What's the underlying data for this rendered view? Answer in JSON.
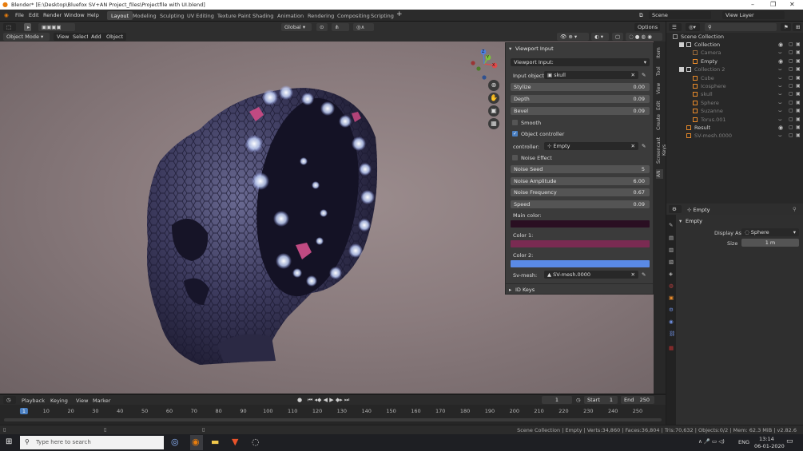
{
  "window": {
    "title": "Blender* [E:\\Desktop\\Bluefox SV+AN Project_files\\Projectfile with UI.blend]"
  },
  "menu": [
    "File",
    "Edit",
    "Render",
    "Window",
    "Help"
  ],
  "workspaces": [
    "Layout",
    "Modeling",
    "Sculpting",
    "UV Editing",
    "Texture Paint",
    "Shading",
    "Animation",
    "Rendering",
    "Compositing",
    "Scripting"
  ],
  "active_workspace": "Layout",
  "scene": {
    "label": "Scene",
    "view_layer": "View Layer"
  },
  "viewport_header": {
    "mode": "Object Mode",
    "menus": [
      "View",
      "Select",
      "Add",
      "Object"
    ],
    "transform": "Global",
    "options": "Options"
  },
  "gizmo": {
    "x": "X",
    "y": "Y",
    "z": "Z"
  },
  "viewport_input": {
    "panel_title": "Viewport Input",
    "type_label": "Viewport Input:",
    "input_object_label": "Input object:",
    "input_object": "skull",
    "stylize_label": "Stylize",
    "stylize": "0.00",
    "depth_label": "Depth",
    "depth": "0.09",
    "bevel_label": "Bevel",
    "bevel": "0.09",
    "smooth_label": "Smooth",
    "smooth": false,
    "object_controller_label": "Object controller",
    "object_controller": true,
    "controller_label": "controller:",
    "controller": "Empty",
    "noise_effect_label": "Noise Effect",
    "noise_effect": false,
    "noise_seed_label": "Noise Seed",
    "noise_seed": "5",
    "noise_amplitude_label": "Noise Amplitude",
    "noise_amplitude": "6.00",
    "noise_frequency_label": "Noise Frequency",
    "noise_frequency": "0.67",
    "speed_label": "Speed",
    "speed": "0.09",
    "main_color_label": "Main color:",
    "main_color": "#2a0f22",
    "color1_label": "Color 1:",
    "color1": "#7a2b52",
    "color2_label": "Color 2:",
    "color2": "#5a8ae6",
    "svmesh_label": "Sv-mesh:",
    "svmesh": "SV-mesh.0000",
    "id_keys_label": "ID Keys"
  },
  "side_tabs": [
    "Item",
    "Tool",
    "View",
    "Edit",
    "Create",
    "Screencast Keys",
    "AN"
  ],
  "outliner": {
    "root": "Scene Collection",
    "rows": [
      {
        "name": "Collection",
        "indent": 1,
        "type": "collection",
        "dim": false
      },
      {
        "name": "Camera",
        "indent": 2,
        "type": "camera",
        "dim": true
      },
      {
        "name": "Empty",
        "indent": 2,
        "type": "empty",
        "dim": false
      },
      {
        "name": "Collection 2",
        "indent": 1,
        "type": "collection",
        "dim": true
      },
      {
        "name": "Cube",
        "indent": 2,
        "type": "mesh",
        "dim": true
      },
      {
        "name": "Icosphere",
        "indent": 2,
        "type": "mesh",
        "dim": true
      },
      {
        "name": "skull",
        "indent": 2,
        "type": "mesh",
        "dim": true
      },
      {
        "name": "Sphere",
        "indent": 2,
        "type": "mesh",
        "dim": true
      },
      {
        "name": "Suzanne",
        "indent": 2,
        "type": "mesh",
        "dim": true
      },
      {
        "name": "Torus.001",
        "indent": 2,
        "type": "mesh",
        "dim": true
      },
      {
        "name": "Result",
        "indent": 1,
        "type": "mesh",
        "dim": false
      },
      {
        "name": "SV-mesh.0000",
        "indent": 1,
        "type": "mesh",
        "dim": true
      }
    ]
  },
  "properties": {
    "object_name": "Empty",
    "panel_title": "Empty",
    "display_as_label": "Display As",
    "display_as": "Sphere",
    "size_label": "Size",
    "size": "1 m"
  },
  "timeline": {
    "menus": [
      "Playback",
      "Keying",
      "View",
      "Marker"
    ],
    "current_frame": "1",
    "start_label": "Start",
    "start": "1",
    "end_label": "End",
    "end": "250",
    "ticks": [
      "1",
      "10",
      "20",
      "30",
      "40",
      "50",
      "60",
      "70",
      "80",
      "90",
      "100",
      "110",
      "120",
      "130",
      "140",
      "150",
      "160",
      "170",
      "180",
      "190",
      "200",
      "210",
      "220",
      "230",
      "240",
      "250"
    ]
  },
  "statusbar": "Scene Collection | Empty | Verts:34,860 | Faces:36,804 | Tris:70,632 | Objects:0/2 | Mem: 62.3 MiB | v2.82.6",
  "taskbar": {
    "search_placeholder": "Type here to search",
    "lang": "ENG",
    "time": "13:14",
    "date": "06-01-2020"
  }
}
